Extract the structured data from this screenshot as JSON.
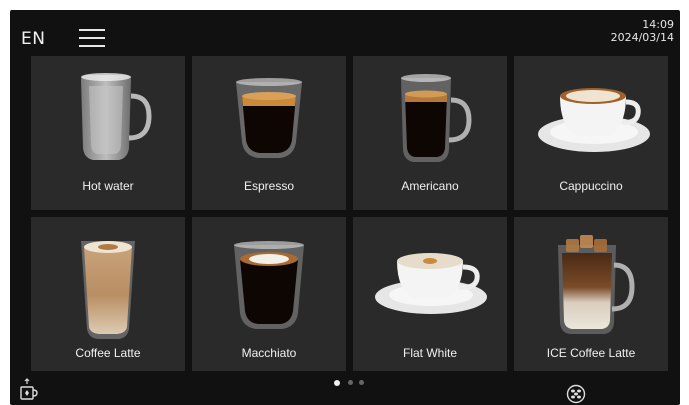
{
  "header": {
    "language": "EN",
    "menu_icon": "hamburger-menu-icon",
    "time": "14:09",
    "date": "2024/03/14"
  },
  "drinks": [
    {
      "label": "Hot water",
      "icon": "glass-mug-empty"
    },
    {
      "label": "Espresso",
      "icon": "glass-cup-espresso"
    },
    {
      "label": "Americano",
      "icon": "glass-mug-americano"
    },
    {
      "label": "Cappuccino",
      "icon": "cup-and-saucer-cappuccino"
    },
    {
      "label": "Coffee Latte",
      "icon": "tall-glass-latte"
    },
    {
      "label": "Macchiato",
      "icon": "glass-cup-macchiato"
    },
    {
      "label": "Flat White",
      "icon": "cup-and-saucer-flat-white"
    },
    {
      "label": "ICE Coffee Latte",
      "icon": "glass-mug-iced-latte"
    }
  ],
  "pagination": {
    "pages": 3,
    "current": 1
  },
  "footer": {
    "left_icon": "hot-water-dispense-icon",
    "right_icon": "coffee-beans-icon"
  },
  "colors": {
    "screen_bg": "#111111",
    "tile_bg": "#2a2a2a",
    "text": "#f0f0f0",
    "coffee_dark": "#0d0603",
    "crema": "#c98a3b",
    "milk": "#efe4d2"
  }
}
